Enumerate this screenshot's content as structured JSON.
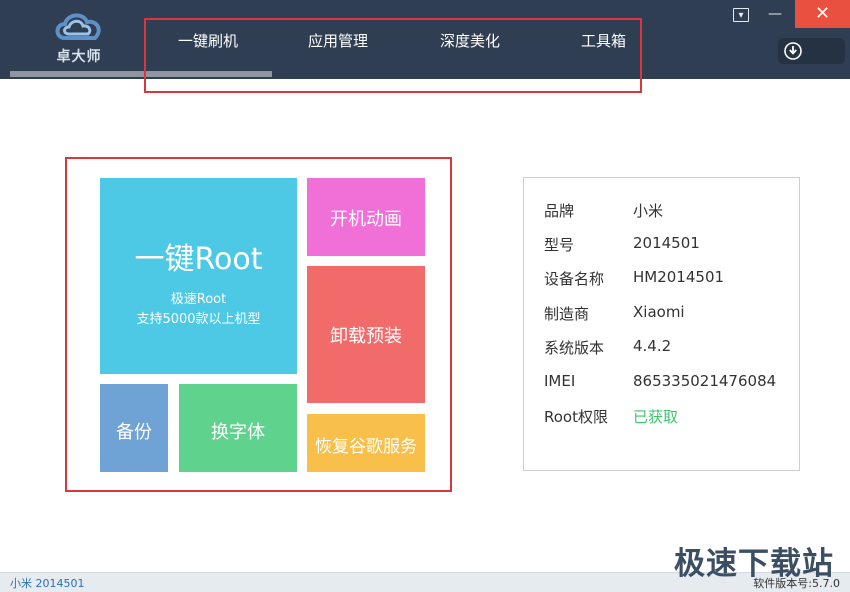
{
  "app": {
    "logo_text": "卓大师"
  },
  "nav": {
    "tabs": [
      {
        "label": "一键刷机",
        "active": true
      },
      {
        "label": "应用管理"
      },
      {
        "label": "深度美化"
      },
      {
        "label": "工具箱"
      }
    ]
  },
  "window_controls": {
    "close_symbol": "✕",
    "minimize_symbol": "▾",
    "restore_symbol": "✕"
  },
  "tiles": {
    "root": {
      "title": "一键Root",
      "subtitle1": "极速Root",
      "subtitle2": "支持5000款以上机型",
      "color": "#4dc9e6"
    },
    "boot_animation": {
      "label": "开机动画",
      "color": "#f070d8"
    },
    "uninstall_preinstalled": {
      "label": "卸载预装",
      "color": "#f26b6b"
    },
    "backup": {
      "label": "备份",
      "color": "#6fa3d6"
    },
    "change_font": {
      "label": "换字体",
      "color": "#5fd38d"
    },
    "restore_google": {
      "label": "恢复谷歌服务",
      "color": "#f8c04a"
    }
  },
  "device_info": {
    "rows": [
      {
        "label": "品牌",
        "value": "小米"
      },
      {
        "label": "型号",
        "value": "2014501"
      },
      {
        "label": "设备名称",
        "value": "HM2014501"
      },
      {
        "label": "制造商",
        "value": "Xiaomi"
      },
      {
        "label": "系统版本",
        "value": "4.4.2"
      },
      {
        "label": "IMEI",
        "value": "865335021476084"
      },
      {
        "label": "Root权限",
        "value": "已获取",
        "status_color": "#3cc46c"
      }
    ]
  },
  "statusbar": {
    "device": "小米 2014501",
    "version": "软件版本号:5.7.0"
  },
  "watermark": {
    "text": "极速下载站"
  }
}
